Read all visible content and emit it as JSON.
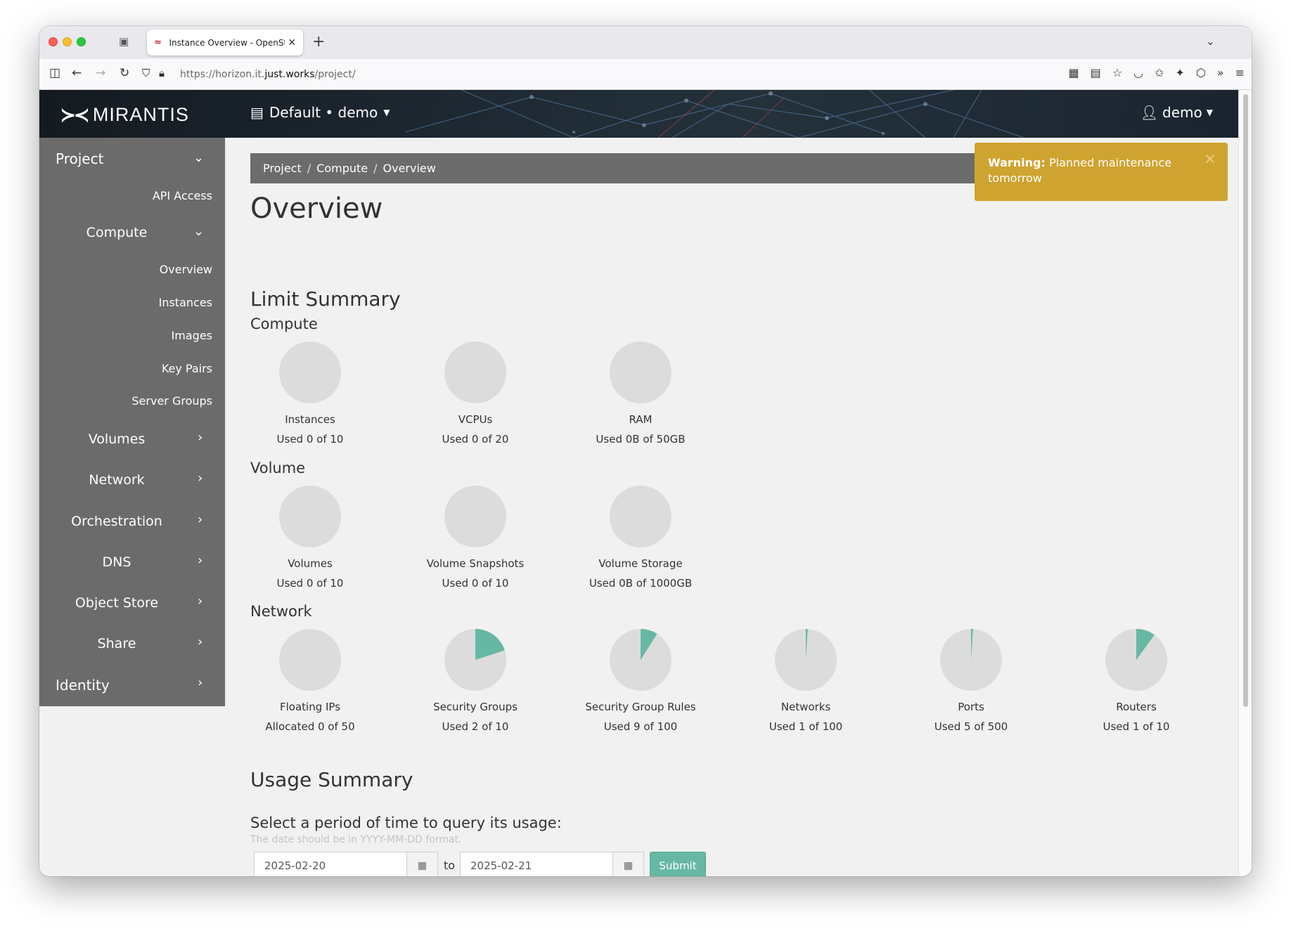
{
  "browser": {
    "tab_title": "Instance Overview - OpenStack",
    "url_prefix": "https://horizon.it.",
    "url_domain": "just.works",
    "url_suffix": "/project/"
  },
  "topbar": {
    "logo": "MIRANTIS",
    "project_picker": "Default • demo",
    "user": "demo"
  },
  "sidebar": {
    "items": [
      {
        "label": "Project"
      },
      {
        "label": "API Access"
      },
      {
        "label": "Compute"
      },
      {
        "label": "Overview"
      },
      {
        "label": "Instances"
      },
      {
        "label": "Images"
      },
      {
        "label": "Key Pairs"
      },
      {
        "label": "Server Groups"
      },
      {
        "label": "Volumes"
      },
      {
        "label": "Network"
      },
      {
        "label": "Orchestration"
      },
      {
        "label": "DNS"
      },
      {
        "label": "Object Store"
      },
      {
        "label": "Share"
      },
      {
        "label": "Identity"
      }
    ]
  },
  "breadcrumb": [
    "Project",
    "Compute",
    "Overview"
  ],
  "alert": {
    "strong": "Warning:",
    "text": "Planned maintenance tomorrow"
  },
  "page_title": "Overview",
  "limit_summary": {
    "title": "Limit Summary",
    "sections": [
      {
        "title": "Compute",
        "charts": [
          {
            "label": "Instances",
            "used": "Used 0 of 10",
            "value": 0,
            "max": 10
          },
          {
            "label": "VCPUs",
            "used": "Used 0 of 20",
            "value": 0,
            "max": 20
          },
          {
            "label": "RAM",
            "used": "Used 0B of 50GB",
            "value": 0,
            "max": 50
          }
        ]
      },
      {
        "title": "Volume",
        "charts": [
          {
            "label": "Volumes",
            "used": "Used 0 of 10",
            "value": 0,
            "max": 10
          },
          {
            "label": "Volume Snapshots",
            "used": "Used 0 of 10",
            "value": 0,
            "max": 10
          },
          {
            "label": "Volume Storage",
            "used": "Used 0B of 1000GB",
            "value": 0,
            "max": 1000
          }
        ]
      },
      {
        "title": "Network",
        "charts": [
          {
            "label": "Floating IPs",
            "used": "Allocated 0 of 50",
            "value": 0,
            "max": 50
          },
          {
            "label": "Security Groups",
            "used": "Used 2 of 10",
            "value": 2,
            "max": 10
          },
          {
            "label": "Security Group Rules",
            "used": "Used 9 of 100",
            "value": 9,
            "max": 100
          },
          {
            "label": "Networks",
            "used": "Used 1 of 100",
            "value": 1,
            "max": 100
          },
          {
            "label": "Ports",
            "used": "Used 5 of 500",
            "value": 5,
            "max": 500
          },
          {
            "label": "Routers",
            "used": "Used 1 of 10",
            "value": 1,
            "max": 10
          }
        ]
      }
    ]
  },
  "usage_summary": {
    "title": "Usage Summary",
    "query_label": "Select a period of time to query its usage:",
    "hint": "The date should be in YYYY-MM-DD format.",
    "start_date": "2025-02-20",
    "end_date": "2025-02-21",
    "to_label": "to",
    "submit_label": "Submit"
  },
  "colors": {
    "pie_fill": "#66b8a4",
    "pie_bg": "#dcdcdc",
    "sidebar": "#6b6b6b",
    "alert": "#cfa32f"
  }
}
